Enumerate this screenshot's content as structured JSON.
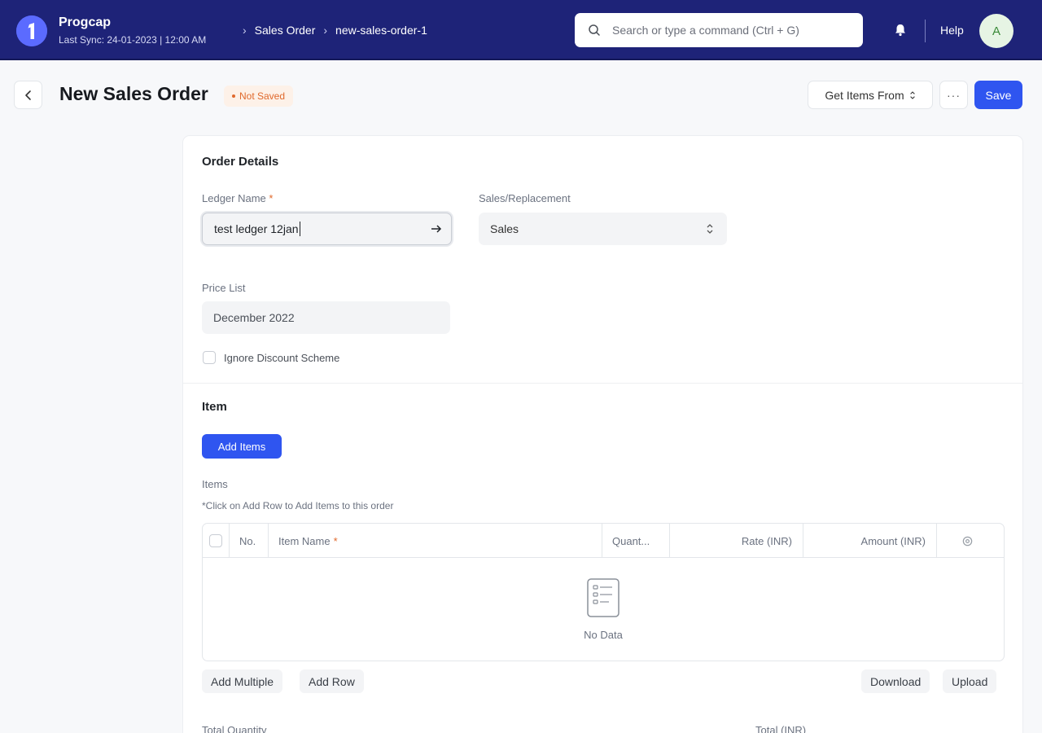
{
  "navbar": {
    "brand": "Progcap",
    "last_sync": "Last Sync: 24-01-2023 | 12:00 AM",
    "breadcrumbs": [
      "Sales Order",
      "new-sales-order-1"
    ],
    "search_placeholder": "Search or type a command (Ctrl + G)",
    "help_label": "Help",
    "avatar_initial": "A"
  },
  "page": {
    "title": "New Sales Order",
    "status": "Not Saved",
    "get_items_label": "Get Items From",
    "more_label": "···",
    "save_label": "Save"
  },
  "order_details": {
    "section_title": "Order Details",
    "ledger_label": "Ledger Name",
    "required_mark": "*",
    "ledger_value": "test ledger 12jan",
    "sales_label": "Sales/Replacement",
    "sales_value": "Sales",
    "price_list_label": "Price List",
    "price_list_value": "December 2022",
    "ignore_discount_label": "Ignore Discount Scheme"
  },
  "item_section": {
    "section_title": "Item",
    "add_items_label": "Add Items",
    "items_label": "Items",
    "hint": "*Click on Add Row to Add Items to this order",
    "columns": {
      "no": "No.",
      "item_name": "Item Name",
      "quantity": "Quant...",
      "rate": "Rate (INR)",
      "amount": "Amount (INR)"
    },
    "empty_text": "No Data",
    "add_multiple_label": "Add Multiple",
    "add_row_label": "Add Row",
    "download_label": "Download",
    "upload_label": "Upload"
  },
  "totals": {
    "total_quantity_label": "Total Quantity",
    "total_inr_label": "Total (INR)"
  },
  "colors": {
    "navbar": "#1e2378",
    "accent": "#2f55f0",
    "status": "#e0692c"
  }
}
